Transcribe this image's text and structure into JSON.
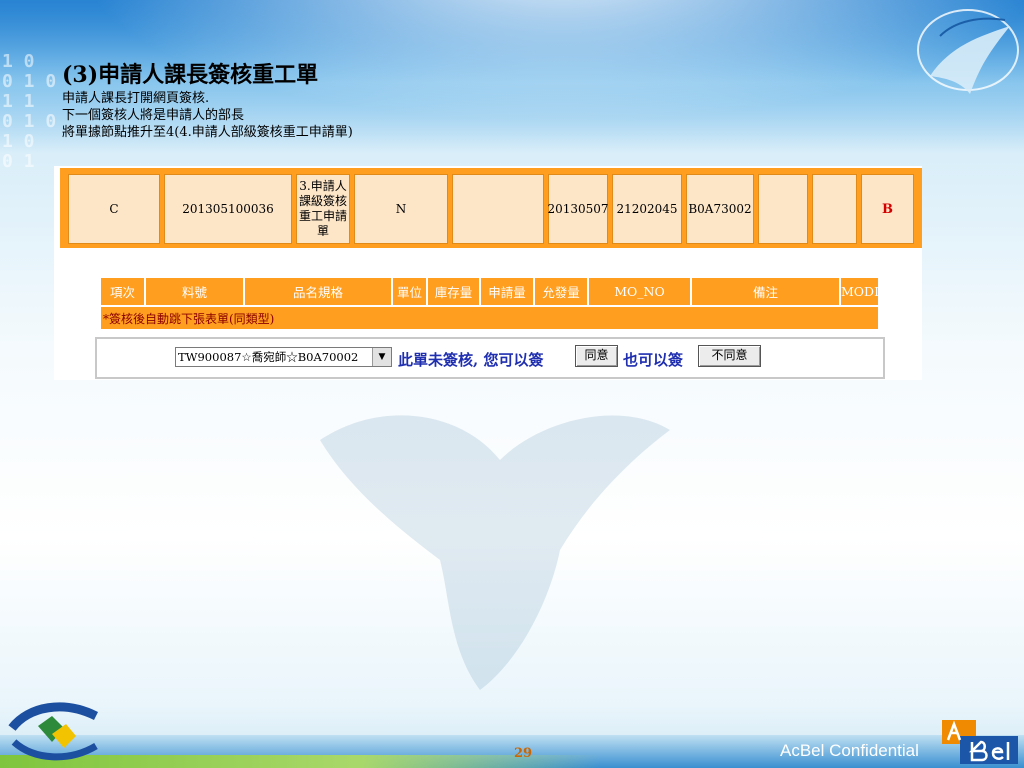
{
  "slide": {
    "title": "(3)申請人課長簽核重工單",
    "lines": [
      "申請人課長打開網頁簽核.",
      "下一個簽核人將是申請人的部長",
      "將單據節點推升至4(4.申請人部級簽核重工申請單)"
    ],
    "page_number": "29",
    "footer_text": "AcBel Confidential"
  },
  "record_row": {
    "cells": [
      "C",
      "201305100036",
      "3.申請人課級簽核重工申請單",
      "N",
      "",
      "20130507",
      "21202045",
      "B0A73002",
      "",
      "",
      "B"
    ]
  },
  "detail_table": {
    "headers": [
      "項次",
      "料號",
      "品名規格",
      "單位",
      "庫存量",
      "申請量",
      "允發量",
      "MO_NO",
      "備注",
      "MODI"
    ],
    "note": "*簽核後自動跳下張表單(同類型)"
  },
  "approval": {
    "selected_option": "TW900087☆喬宛師☆B0A70002",
    "message_1": "此單未簽核, 您可以簽",
    "agree_label": "同意",
    "message_2": "也可以簽",
    "disagree_label": "不同意"
  },
  "colors": {
    "accent_orange": "#ff9e1f",
    "cell_fill": "#fde6c8",
    "message_blue": "#1f2fb0"
  }
}
